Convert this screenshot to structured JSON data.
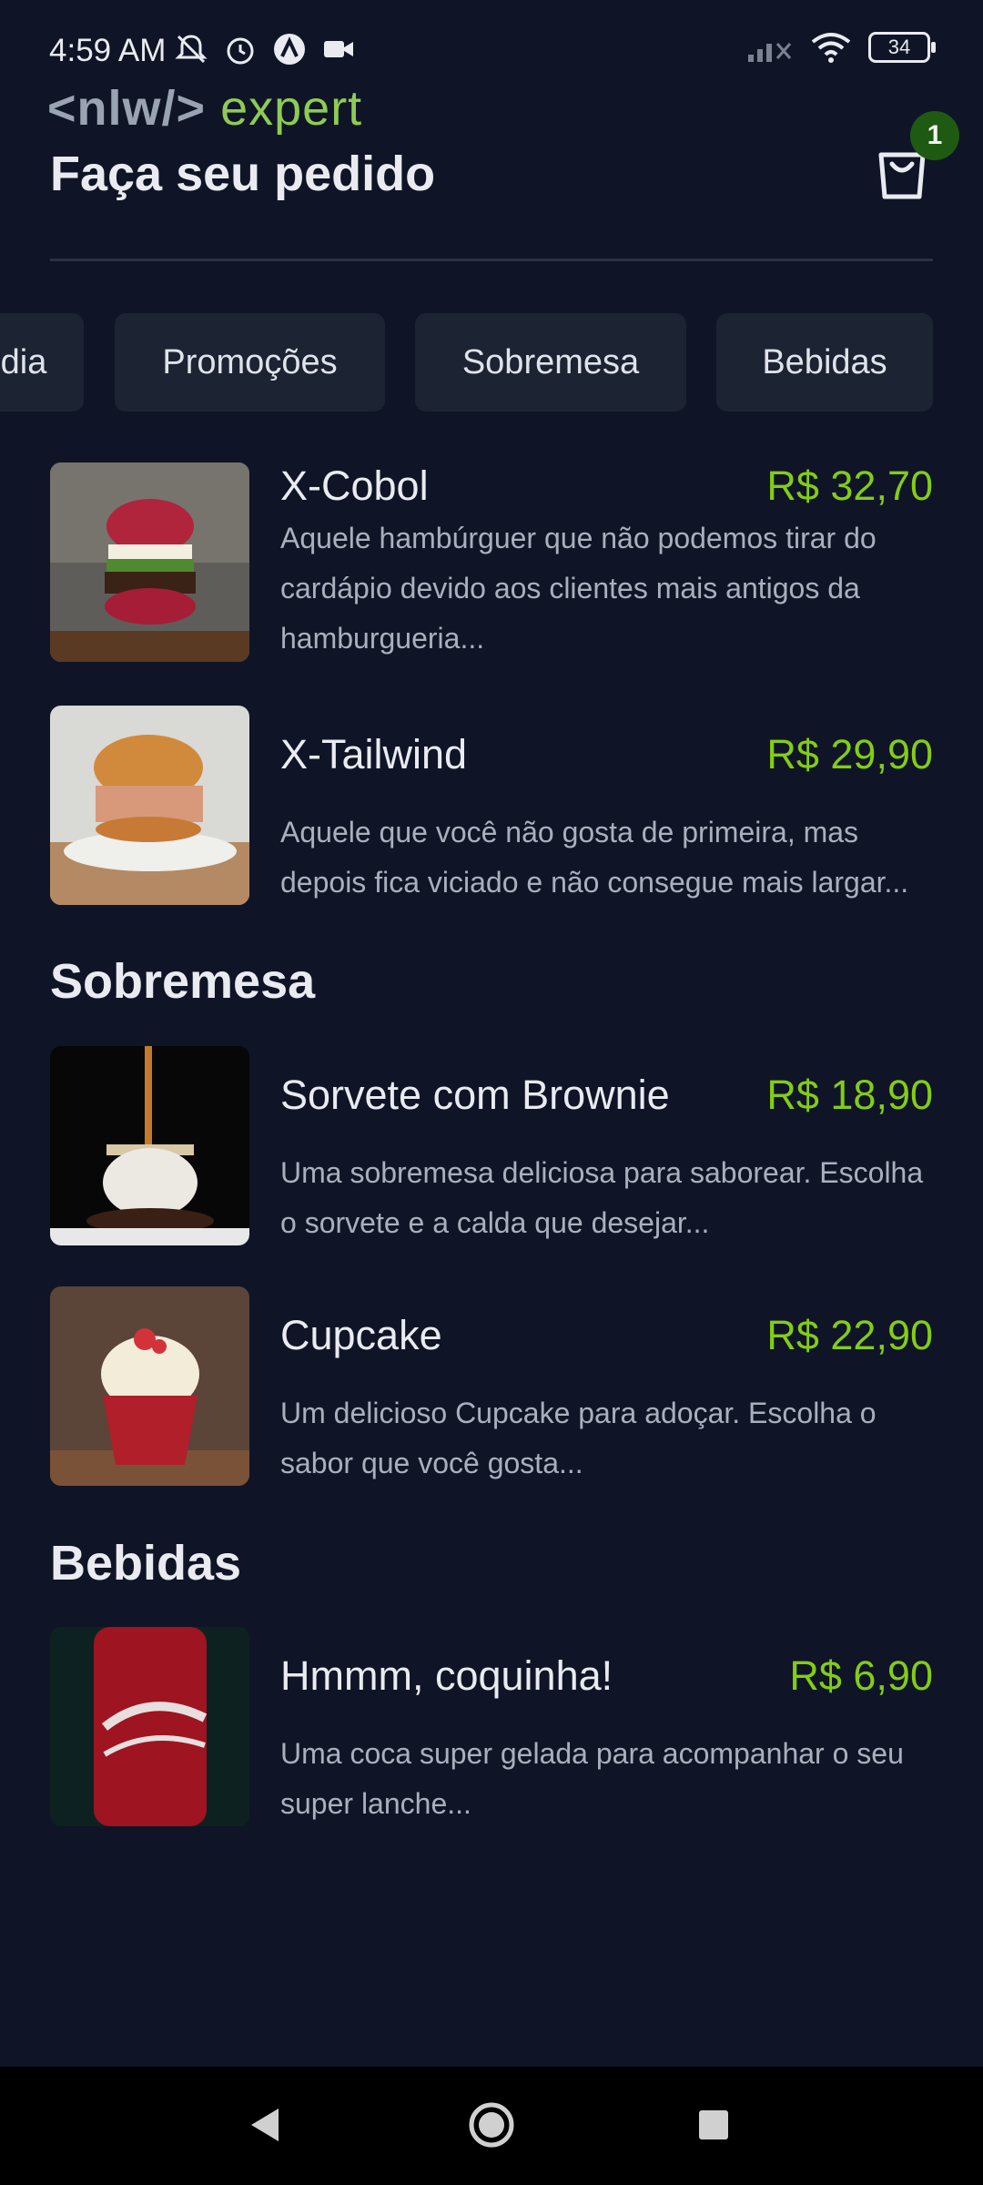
{
  "status": {
    "time": "4:59 AM",
    "battery": "34"
  },
  "logo": {
    "prefix": "<nlw/>",
    "word": "expert"
  },
  "header": {
    "title": "Faça seu pedido",
    "cart_count": "1"
  },
  "categories": [
    "dia",
    "Promoções",
    "Sobremesa",
    "Bebidas"
  ],
  "items": [
    {
      "name": "X-Cobol",
      "price": "R$ 32,70",
      "description": "Aquele hambúrguer que não podemos tirar do cardápio devido aos clientes mais antigos da hamburgueria..."
    },
    {
      "name": "X-Tailwind",
      "price": "R$ 29,90",
      "description": "Aquele que você não gosta de primeira, mas depois fica viciado e não consegue mais largar..."
    }
  ],
  "sections": [
    {
      "title": "Sobremesa",
      "items": [
        {
          "name": "Sorvete com Brownie",
          "price": "R$ 18,90",
          "description": "Uma sobremesa deliciosa para saborear. Escolha o sorvete e a calda que desejar..."
        },
        {
          "name": "Cupcake",
          "price": "R$ 22,90",
          "description": "Um delicioso Cupcake para adoçar. Escolha o sabor que você gosta..."
        }
      ]
    },
    {
      "title": "Bebidas",
      "items": [
        {
          "name": "Hmmm, coquinha!",
          "price": "R$ 6,90",
          "description": "Uma coca super gelada para acompanhar o seu super lanche..."
        }
      ]
    }
  ],
  "colors": {
    "background": "#0f1526",
    "accent_price": "#84cc16",
    "chip": "#1c2333",
    "badge": "#1f5a12"
  }
}
